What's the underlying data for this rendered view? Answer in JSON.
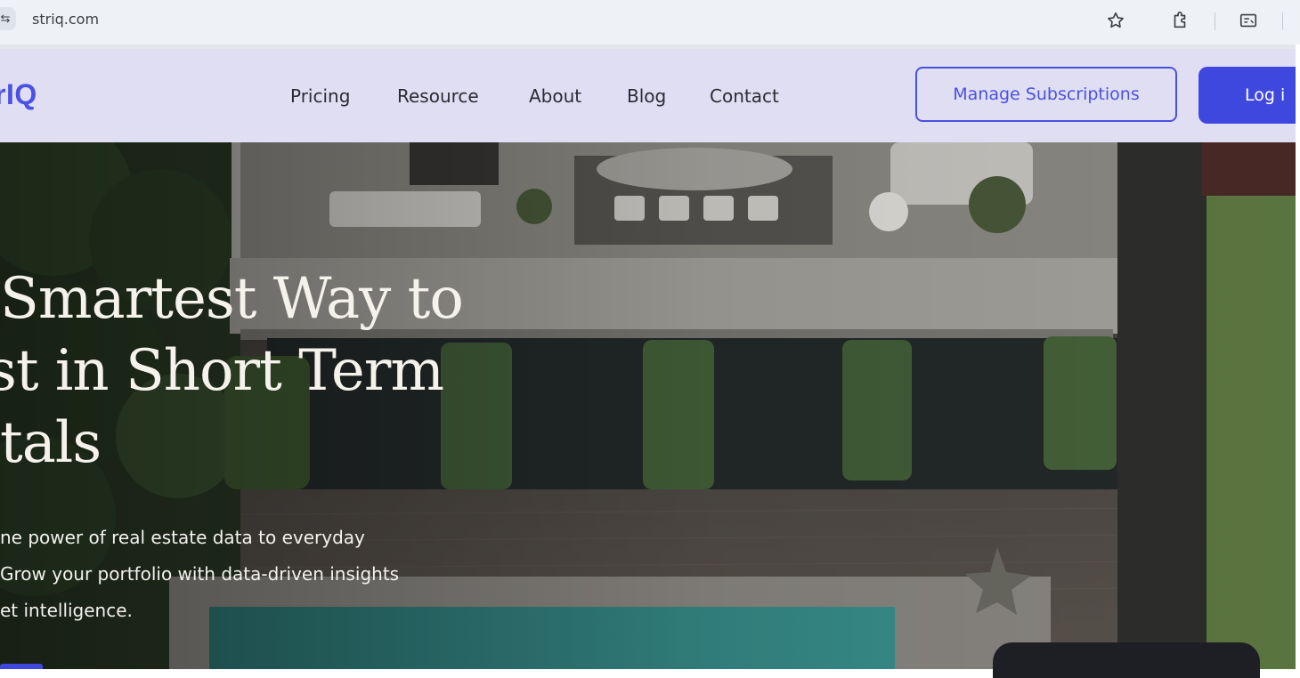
{
  "browser": {
    "url": "striq.com",
    "icons": [
      "site-settings-icon",
      "star-icon",
      "extensions-icon",
      "reading-mode-icon"
    ]
  },
  "header": {
    "logo": "rIQ",
    "nav": [
      "Pricing",
      "Resource",
      "About",
      "Blog",
      "Contact"
    ],
    "manage_label": "Manage Subscriptions",
    "login_label": "Log i",
    "colors": {
      "accent": "#4a51e2",
      "header_bg": "#e0def3"
    }
  },
  "hero": {
    "title_lines": [
      "Smartest Way to",
      "st in Short Term",
      "tals"
    ],
    "subtitle_lines": [
      "ne power of real estate data to everyday",
      " Grow your portfolio with data-driven insights",
      "et intelligence."
    ]
  }
}
